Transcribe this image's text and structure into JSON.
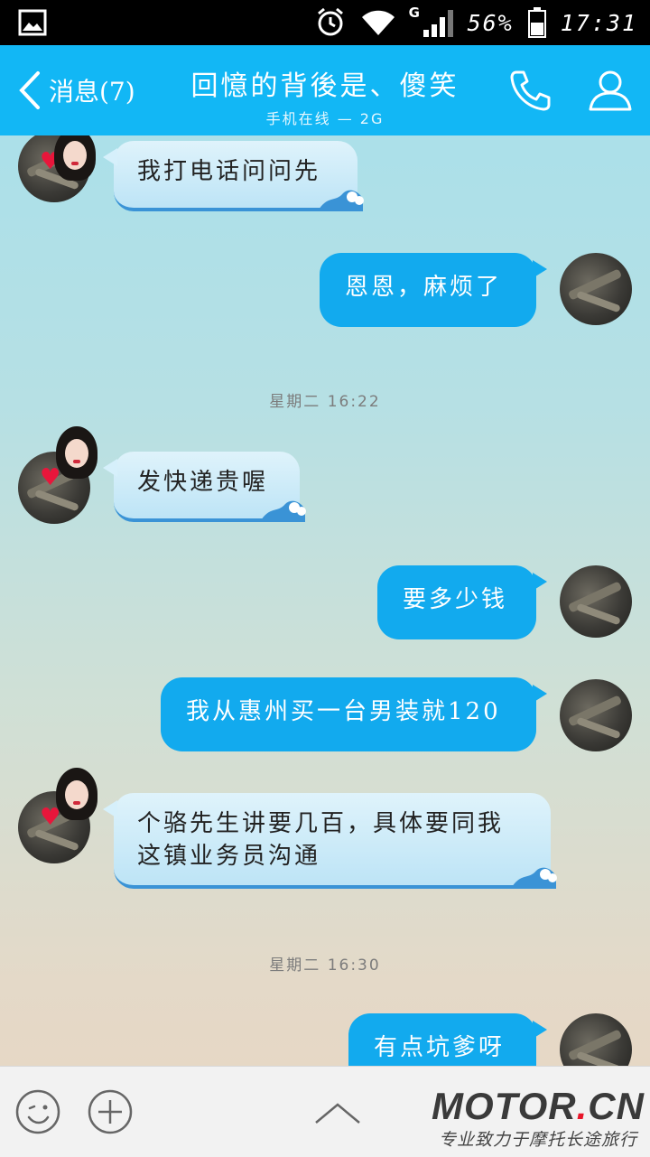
{
  "status_bar": {
    "network": "G",
    "battery": "56%",
    "time": "17:31"
  },
  "header": {
    "back_label": "消息(7)",
    "title": "回憶的背後是、傻笑",
    "subtitle": "手机在线 — 2G"
  },
  "messages": [
    {
      "side": "in",
      "text": "我打电话问问先"
    },
    {
      "side": "out",
      "text": "恩恩，麻烦了"
    },
    {
      "timestamp": "星期二 16:22"
    },
    {
      "side": "in",
      "text": "发快递贵喔"
    },
    {
      "side": "out",
      "text": "要多少钱"
    },
    {
      "side": "out",
      "text": "我从惠州买一台男装就120"
    },
    {
      "side": "in",
      "text": "个骆先生讲要几百，具体要同我这镇业务员沟通"
    },
    {
      "timestamp": "星期二 16:30"
    },
    {
      "side": "out",
      "text": "有点坑爹呀"
    }
  ],
  "timestamps": [
    "星期二 16:22",
    "星期二 16:30"
  ],
  "watermark": {
    "logo_left": "MOTOR",
    "logo_right": "CN",
    "tagline": "专业致力于摩托长途旅行"
  },
  "colors": {
    "header_bg": "#12b7f5",
    "out_bubble": "#12aaee",
    "in_bubble": "#d6f0fb"
  },
  "icons": [
    "image-icon",
    "alarm-icon",
    "wifi-icon",
    "signal-icon",
    "battery-icon",
    "back-chevron-icon",
    "phone-icon",
    "profile-icon",
    "emoji-icon",
    "plus-icon",
    "chevron-up-icon"
  ]
}
